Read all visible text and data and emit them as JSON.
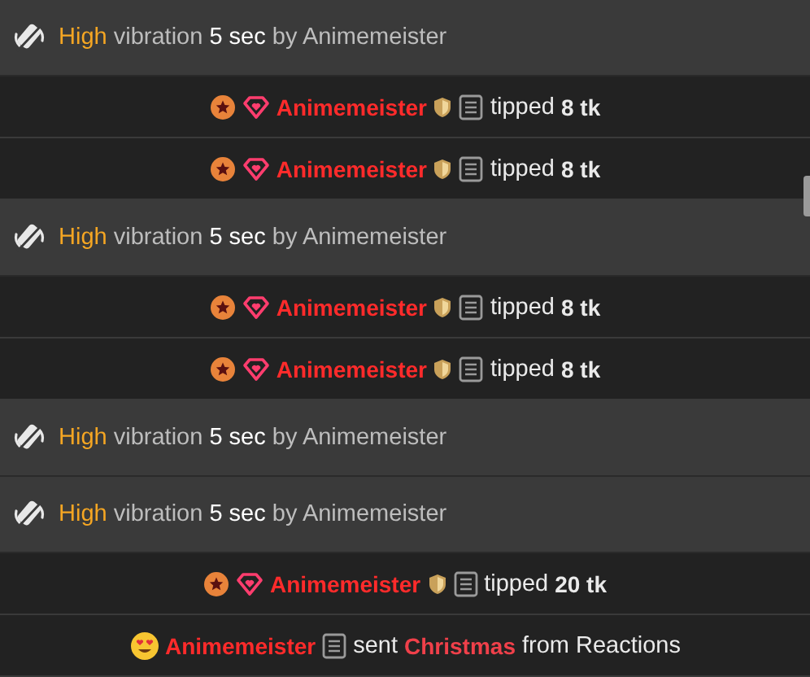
{
  "messages": [
    {
      "kind": "vibration",
      "intensity": "High",
      "action": "vibration",
      "duration": "5 sec",
      "by": "by Animemeister"
    },
    {
      "kind": "tip",
      "user": "Animemeister",
      "verb": "tipped",
      "amount": "8 tk"
    },
    {
      "kind": "tip",
      "user": "Animemeister",
      "verb": "tipped",
      "amount": "8 tk"
    },
    {
      "kind": "vibration",
      "intensity": "High",
      "action": "vibration",
      "duration": "5 sec",
      "by": "by Animemeister"
    },
    {
      "kind": "tip",
      "user": "Animemeister",
      "verb": "tipped",
      "amount": "8 tk"
    },
    {
      "kind": "tip",
      "user": "Animemeister",
      "verb": "tipped",
      "amount": "8 tk"
    },
    {
      "kind": "vibration",
      "intensity": "High",
      "action": "vibration",
      "duration": "5 sec",
      "by": "by Animemeister"
    },
    {
      "kind": "vibration",
      "intensity": "High",
      "action": "vibration",
      "duration": "5 sec",
      "by": "by Animemeister"
    },
    {
      "kind": "tip",
      "user": "Animemeister",
      "verb": "tipped",
      "amount": "20 tk"
    },
    {
      "kind": "reaction",
      "user": "Animemeister",
      "verb": "sent",
      "item": "Christmas",
      "suffix": "from Reactions"
    }
  ]
}
